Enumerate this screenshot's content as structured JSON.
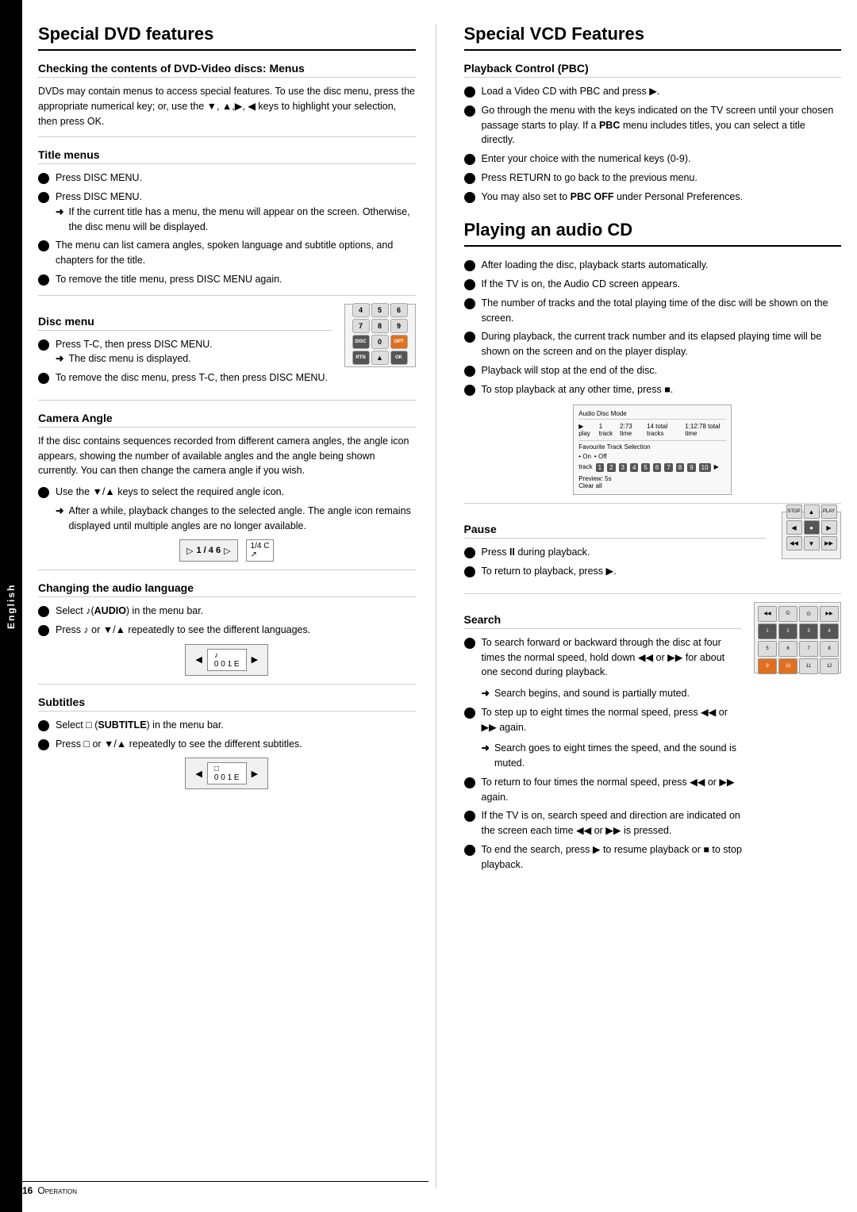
{
  "page": {
    "language_tab": "English",
    "footer_page_num": "16",
    "footer_label": "Operation"
  },
  "left_col": {
    "title": "Special DVD features",
    "section1": {
      "heading": "Checking the contents of DVD-Video discs: Menus",
      "body": "DVDs may contain menus to access special features. To use the disc menu, press the appropriate numerical key; or, use the ▼, ▲,▶, ◀ keys to highlight your selection, then press OK."
    },
    "title_menus": {
      "heading": "Title menus",
      "items": [
        "Press DISC MENU.",
        "If the current title has a menu, the menu will appear on the screen. Otherwise, the disc menu will be displayed.",
        "The menu can list camera angles, spoken language and subtitle options, and chapters for the title.",
        "To remove the title menu, press DISC MENU again."
      ],
      "arrow1": "If the current title has a menu, the menu will appear on the screen. Otherwise, the disc menu will be displayed."
    },
    "disc_menu": {
      "heading": "Disc menu",
      "items": [
        "Press T-C, then press DISC MENU.",
        "The disc menu is displayed.",
        "To remove the disc menu, press T-C, then press DISC MENU."
      ],
      "arrow1": "The disc menu is displayed."
    },
    "camera_angle": {
      "heading": "Camera Angle",
      "body": "If the disc contains sequences recorded from different camera angles, the angle icon appears, showing the number of available angles and the angle being shown currently. You can then change the camera angle if you wish.",
      "items": [
        "Use the ▼/▲ keys to select the required angle icon.",
        "After a while, playback changes to the selected angle. The angle icon remains displayed until multiple angles are no longer available."
      ],
      "arrow1": "After a while, playback changes to the selected angle. The angle icon remains displayed until multiple angles are no longer available."
    },
    "audio_language": {
      "heading": "Changing the audio language",
      "items": [
        "Select  (AUDIO) in the menu bar.",
        "Press  or ▼/▲ repeatedly to see the different languages."
      ]
    },
    "subtitles": {
      "heading": "Subtitles",
      "items": [
        "Select  (SUBTITLE) in the menu bar.",
        "Press  or ▼/▲ repeatedly to see the different subtitles."
      ]
    }
  },
  "right_col": {
    "title1": "Special VCD Features",
    "pbc": {
      "heading": "Playback Control (PBC)",
      "items": [
        "Load a Video CD with PBC and press ▶.",
        "Go through the menu with the keys indicated on the TV screen until your chosen passage starts to play. If a PBC menu includes titles, you can select a title directly.",
        "Enter your choice with the numerical keys (0-9).",
        "Press RETURN to go back to the previous menu.",
        "You may also set to PBC OFF under Personal Preferences."
      ]
    },
    "title2": "Playing an audio CD",
    "audio_cd": {
      "items": [
        "After loading the disc, playback starts automatically.",
        "If the TV is on, the Audio CD screen appears.",
        "The number of tracks and the total playing time of the disc will be shown on the screen.",
        "During playback, the current track number and its elapsed playing time will be shown on the screen and on the player display.",
        "Playback will stop at the end of the disc.",
        "To stop playback at any other time, press ■."
      ]
    },
    "pause": {
      "heading": "Pause",
      "items": [
        "Press II during playback.",
        "To return to playback, press ▶."
      ]
    },
    "search": {
      "heading": "Search",
      "items": [
        "To search forward or backward through the disc at four times the normal speed, hold down ◀◀ or ▶▶ for about one second during playback.",
        "Search begins, and sound is partially muted.",
        "To step up to eight times the normal speed, press ◀◀ or ▶▶ again.",
        "Search goes to eight times the speed, and the sound is muted.",
        "To return to four times the normal speed, press ◀◀ or ▶▶ again.",
        "If the TV is on, search speed and direction are indicated on the screen each time ◀◀ or ▶▶ is pressed.",
        "To end the search, press ▶ to resume playback or ■ to stop playback."
      ],
      "arrow1": "Search begins, and sound is partially muted.",
      "arrow2": "Search goes to eight times the speed, and the sound is muted."
    }
  },
  "labels": {
    "select": "Select",
    "press": "Press"
  }
}
